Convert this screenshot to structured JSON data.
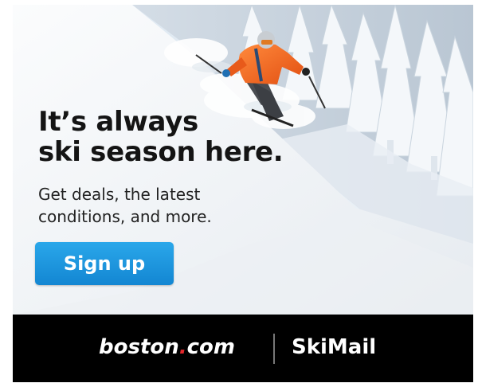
{
  "colors": {
    "button": "#1a96e0",
    "footer_bg": "#000000",
    "headline": "#141414",
    "brand_dot": "#e3282c",
    "jacket": "#f26a22"
  },
  "photo": {
    "icon": "skier-photo"
  },
  "headline": {
    "line1": "It’s always",
    "line2": "ski season here."
  },
  "subtext": {
    "line1": "Get deals, the latest",
    "line2": "conditions, and more."
  },
  "cta": {
    "label": "Sign up"
  },
  "footer": {
    "brand_part1": "boston",
    "brand_dot": ".",
    "brand_part2": "com",
    "product": "SkiMail"
  }
}
